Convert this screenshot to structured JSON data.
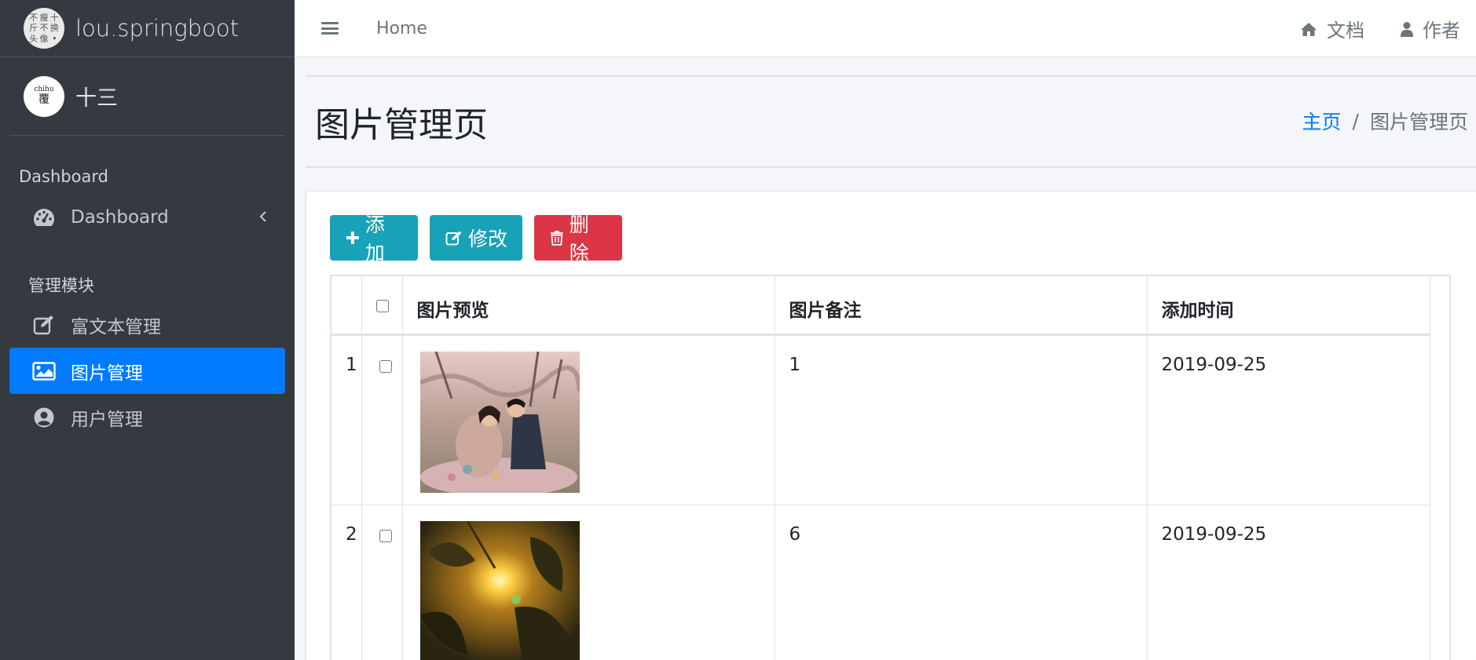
{
  "brand": {
    "logo_chars": [
      "不",
      "瘦",
      "十",
      "斤",
      "不",
      "换",
      "头",
      "像",
      "•"
    ],
    "name": "lou.springboot"
  },
  "user": {
    "avatar_top": "chihu",
    "avatar_char": "覆",
    "name": "十三"
  },
  "sidebar": {
    "section1": "Dashboard",
    "dashboard_item": "Dashboard",
    "section2": "管理模块",
    "items": [
      {
        "label": "富文本管理",
        "icon": "edit-icon"
      },
      {
        "label": "图片管理",
        "icon": "image-icon"
      },
      {
        "label": "用户管理",
        "icon": "user-circle-icon"
      }
    ],
    "active_color": "#007bff"
  },
  "topnav": {
    "home": "Home",
    "docs": "文档",
    "author": "作者"
  },
  "header": {
    "title": "图片管理页",
    "breadcrumb_home": "主页",
    "breadcrumb_sep": "/",
    "breadcrumb_current": "图片管理页"
  },
  "toolbar": {
    "add": "添加",
    "edit": "修改",
    "delete": "删除"
  },
  "table": {
    "headers": [
      "",
      "",
      "图片预览",
      "图片备注",
      "添加时间"
    ],
    "rows": [
      {
        "index": "1",
        "note": "1",
        "date": "2019-09-25",
        "image": "couple-photo"
      },
      {
        "index": "2",
        "note": "6",
        "date": "2019-09-25",
        "image": "sunlight-leaves-photo"
      }
    ]
  }
}
